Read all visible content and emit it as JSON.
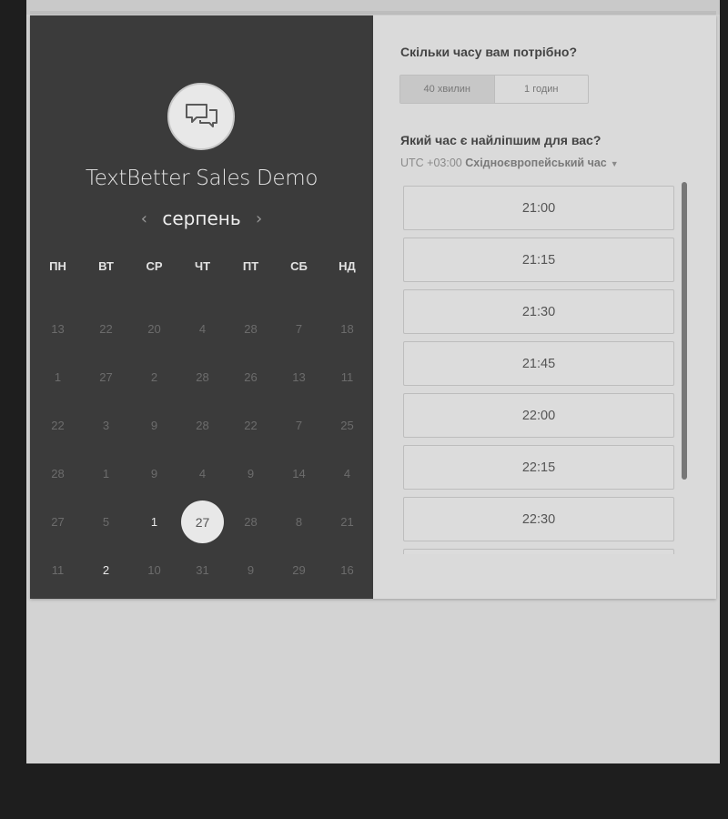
{
  "app": {
    "title": "TextBetter Sales Demo"
  },
  "calendar": {
    "month": "серпень",
    "prev_icon": "chevron-left-icon",
    "next_icon": "chevron-right-icon",
    "weekdays": [
      "ПН",
      "ВТ",
      "СР",
      "ЧТ",
      "ПТ",
      "СБ",
      "НД"
    ],
    "weeks": [
      [
        {
          "d": "13"
        },
        {
          "d": "22"
        },
        {
          "d": "20"
        },
        {
          "d": "4"
        },
        {
          "d": "28"
        },
        {
          "d": "7"
        },
        {
          "d": "18"
        }
      ],
      [
        {
          "d": "1"
        },
        {
          "d": "27"
        },
        {
          "d": "2"
        },
        {
          "d": "28"
        },
        {
          "d": "26"
        },
        {
          "d": "13"
        },
        {
          "d": "11"
        }
      ],
      [
        {
          "d": "22"
        },
        {
          "d": "3"
        },
        {
          "d": "9"
        },
        {
          "d": "28"
        },
        {
          "d": "22"
        },
        {
          "d": "7"
        },
        {
          "d": "25"
        }
      ],
      [
        {
          "d": "28"
        },
        {
          "d": "1"
        },
        {
          "d": "9"
        },
        {
          "d": "4"
        },
        {
          "d": "9"
        },
        {
          "d": "14"
        },
        {
          "d": "4"
        }
      ],
      [
        {
          "d": "27"
        },
        {
          "d": "5"
        },
        {
          "d": "1",
          "avail": true
        },
        {
          "d": "27",
          "selected": true
        },
        {
          "d": "28"
        },
        {
          "d": "8"
        },
        {
          "d": "21"
        }
      ],
      [
        {
          "d": "11"
        },
        {
          "d": "2",
          "avail": true
        },
        {
          "d": "10"
        },
        {
          "d": "31"
        },
        {
          "d": "9"
        },
        {
          "d": "29"
        },
        {
          "d": "16"
        }
      ]
    ]
  },
  "booking": {
    "duration_question": "Скільки часу вам потрібно?",
    "durations": [
      {
        "label": "40 хвилин",
        "active": true
      },
      {
        "label": "1 годин",
        "active": false
      }
    ],
    "time_question": "Який час є найліпшим для вас?",
    "timezone_prefix": "UTC +03:00",
    "timezone_name": "Східноєвропейський час",
    "timezone_icon": "caret-down-icon",
    "slots": [
      "21:00",
      "21:15",
      "21:30",
      "21:45",
      "22:00",
      "22:15",
      "22:30",
      ""
    ]
  }
}
